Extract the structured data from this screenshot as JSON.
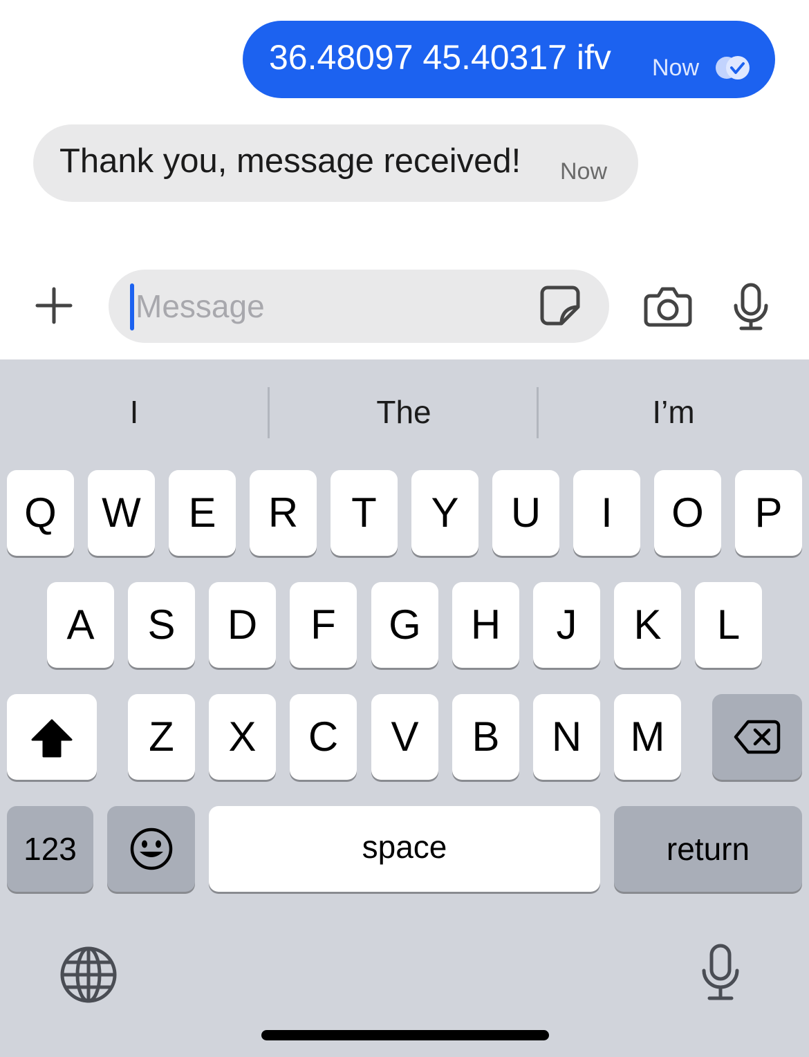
{
  "messages": [
    {
      "direction": "outgoing",
      "text": "36.48097 45.40317 ifv",
      "time": "Now"
    },
    {
      "direction": "incoming",
      "text": "Thank you, message received!",
      "time": "Now"
    }
  ],
  "composer": {
    "placeholder": "Message",
    "icons": [
      "plus-icon",
      "sticker-icon",
      "camera-icon",
      "microphone-icon"
    ]
  },
  "keyboard": {
    "suggestions": [
      "I",
      "The",
      "I’m"
    ],
    "row1": [
      "Q",
      "W",
      "E",
      "R",
      "T",
      "Y",
      "U",
      "I",
      "O",
      "P"
    ],
    "row2": [
      "A",
      "S",
      "D",
      "F",
      "G",
      "H",
      "J",
      "K",
      "L"
    ],
    "row3": [
      "Z",
      "X",
      "C",
      "V",
      "B",
      "N",
      "M"
    ],
    "numbers_label": "123",
    "space_label": "space",
    "return_label": "return",
    "icons": [
      "shift-icon",
      "backspace-icon",
      "emoji-icon",
      "globe-icon",
      "dictation-icon"
    ]
  },
  "colors": {
    "accent": "#1c62f0",
    "incoming_bubble": "#e9e9ea",
    "keyboard_bg": "#d1d4db",
    "key_dark": "#a9aeb8"
  }
}
